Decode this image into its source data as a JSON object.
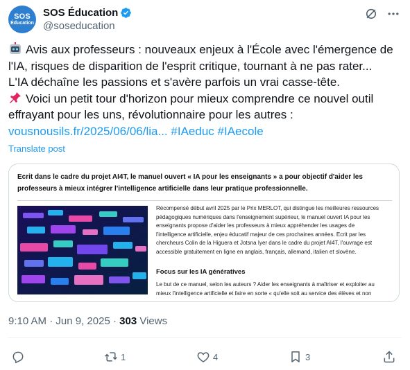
{
  "author": {
    "avatar_line1": "SOS",
    "avatar_line2": "Éducation",
    "display_name": "SOS Éducation",
    "handle": "@soseducation",
    "verified": true
  },
  "tweet": {
    "lines": [
      "Avis aux professeurs : nouveaux enjeux à l'École avec l'émergence de",
      "l'IA, risques de disparition de l'esprit critique, tournant à ne pas rater...",
      "L'IA déchaîne les passions et s'avère parfois un vrai casse-tête.",
      "Voici un petit tour d'horizon pour mieux comprendre ce nouvel outil",
      "effrayant pour les uns, révolutionnaire pour les autres :"
    ],
    "link": "vousnousils.fr/2025/06/06/lia...",
    "hashtags": [
      "#IAeduc",
      "#IAecole"
    ],
    "emoji_1": "robot-emoji",
    "emoji_2": "pushpin-emoji",
    "translate_label": "Translate post"
  },
  "card": {
    "intro_line1": "Ecrit dans le cadre du projet AI4T, le manuel ouvert « IA pour les enseignants » a pour objectif d'aider les",
    "intro_line2": "professeurs à mieux intégrer l'intelligence artificielle dans leur pratique professionnelle.",
    "body_lines": [
      "Récompensé début avril 2025 par le Prix MERLOT, qui distingue les meilleures ressources",
      "pédagogiques numériques dans l'enseignement supérieur, le manuel ouvert IA pour les",
      "enseignants propose d'aider les professeurs à mieux appréhender les usages de",
      "l'intelligence artificielle, enjeu éducatif majeur de ces prochaines années. Ecrit par les",
      "chercheurs Colin de la Higuera et Jotsna Iyer dans le cadre du projet AI4T, l'ouvrage est",
      "accessible gratuitement en ligne en anglais, français, allemand, italien et slovène."
    ],
    "section_heading": "Focus sur les IA génératives",
    "section_lines": [
      "Le but de ce manuel, selon les auteurs ? Aider les enseignants à maîtriser et exploiter au",
      "mieux l'intelligence artificielle et faire en sorte « qu'elle soit au service des élèves et non"
    ]
  },
  "meta": {
    "time": "9:10 AM",
    "separator": "·",
    "date": "Jun 9, 2025",
    "separator2": "·",
    "views": "303",
    "views_label": "Views"
  },
  "actions": {
    "replies": "",
    "reposts": "1",
    "likes": "4",
    "bookmarks": "3"
  },
  "colors": {
    "accent": "#1d9bf0",
    "text": "#0f1419",
    "secondary": "#536471",
    "verified": "#1d9bf0",
    "avatar_bg": "#2f7fd1"
  }
}
